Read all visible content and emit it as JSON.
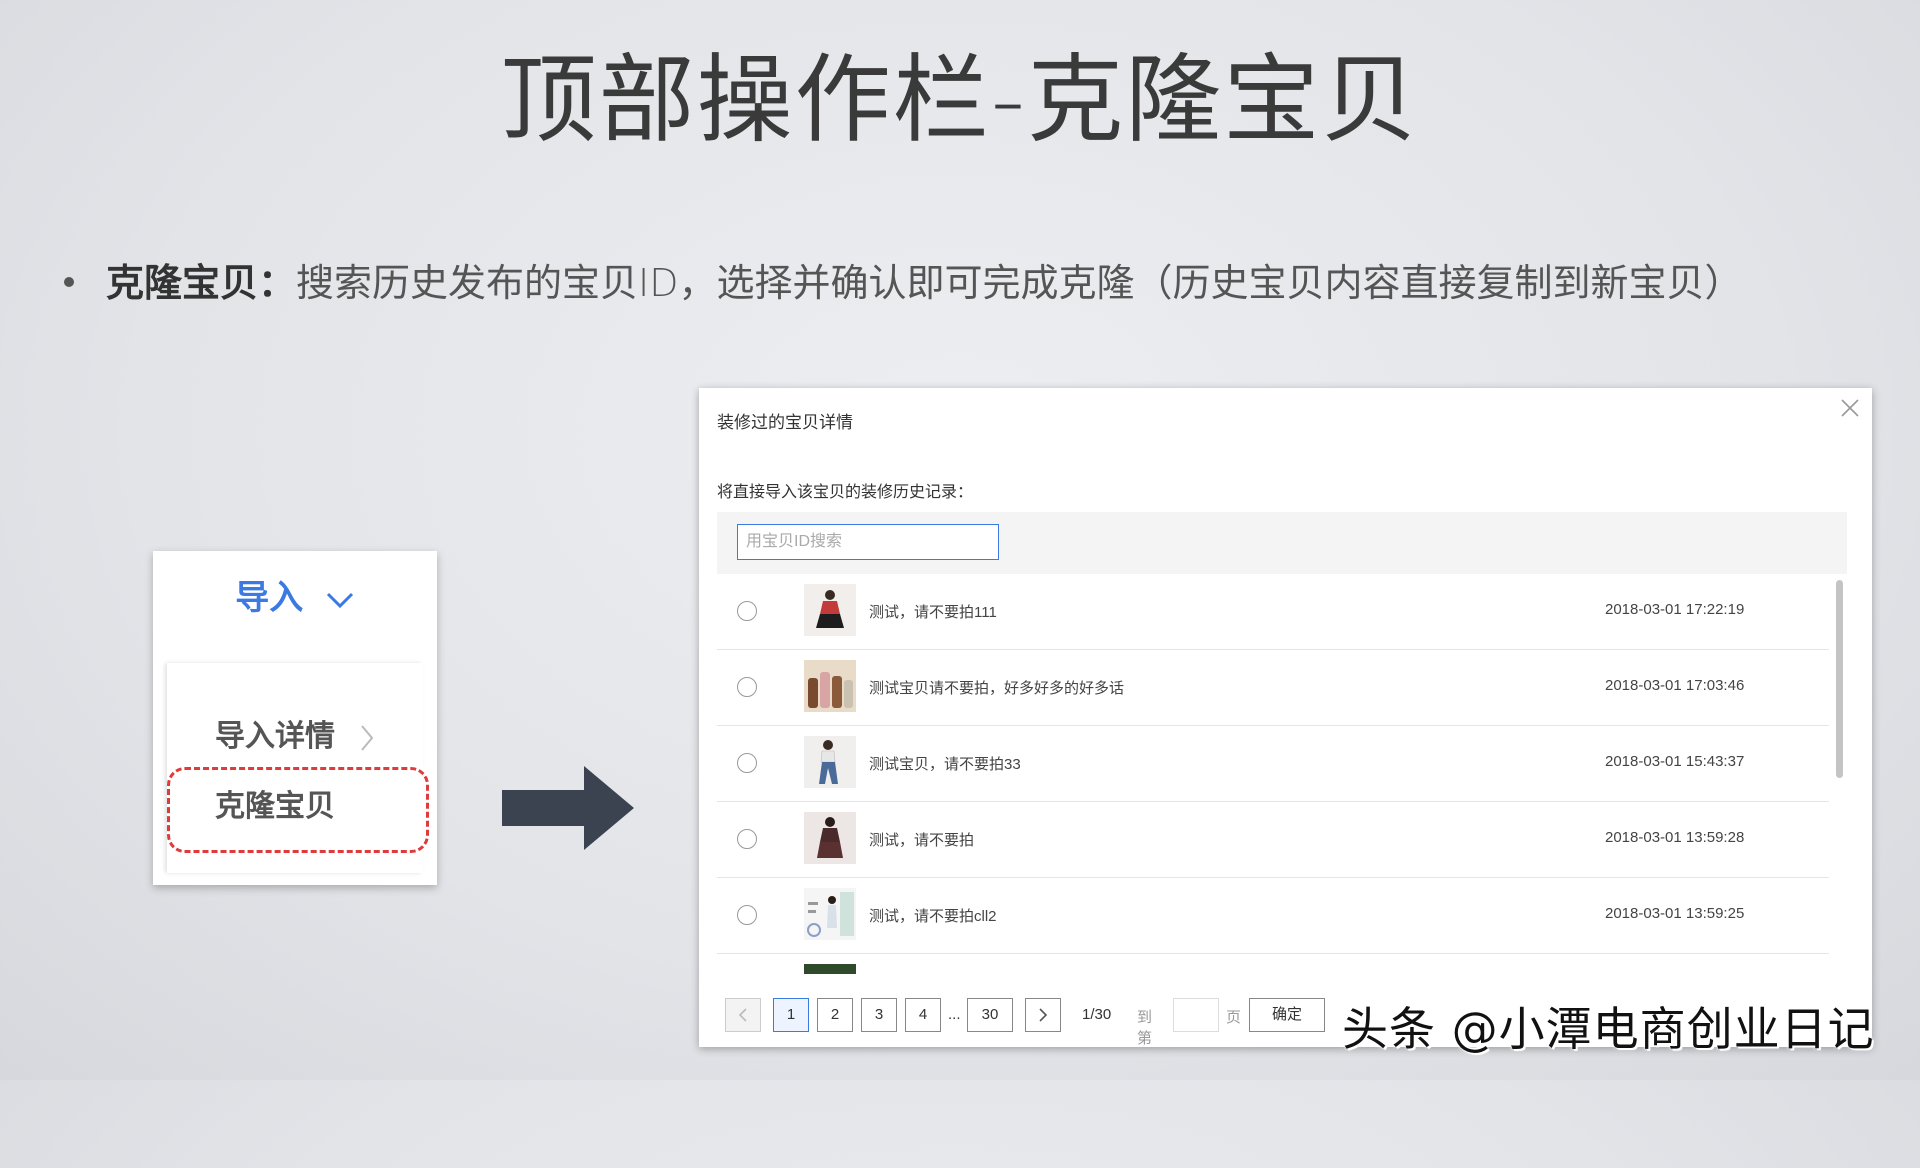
{
  "slide": {
    "title": "顶部操作栏-克隆宝贝",
    "bullet_term": "克隆宝贝：",
    "bullet_desc": "搜索历史发布的宝贝ID，选择并确认即可完成克隆（历史宝贝内容直接复制到新宝贝）"
  },
  "menu": {
    "header_label": "导入",
    "items": [
      {
        "label": "导入详情"
      },
      {
        "label": "克隆宝贝"
      }
    ],
    "highlight_color": "#e03a3a",
    "accent_color": "#3b7ae2"
  },
  "dialog": {
    "title": "装修过的宝贝详情",
    "subtitle": "将直接导入该宝贝的装修历史记录：",
    "search": {
      "placeholder": "用宝贝ID搜索",
      "value": ""
    },
    "rows": [
      {
        "name": "测试，请不要拍111",
        "time": "2018-03-01 17:22:19",
        "thumb": "thumb-dress-red"
      },
      {
        "name": "测试宝贝请不要拍，好多好多的好多话",
        "time": "2018-03-01 17:03:46",
        "thumb": "thumb-fan-bottles"
      },
      {
        "name": "测试宝贝，请不要拍33",
        "time": "2018-03-01 15:43:37",
        "thumb": "thumb-jeans"
      },
      {
        "name": "测试，请不要拍",
        "time": "2018-03-01 13:59:28",
        "thumb": "thumb-lace-dress"
      },
      {
        "name": "测试，请不要拍cll2",
        "time": "2018-03-01 13:59:25",
        "thumb": "thumb-girl-detail"
      }
    ],
    "pager": {
      "pages": [
        "1",
        "2",
        "3",
        "4"
      ],
      "ellipsis": "...",
      "last": "30",
      "status": "1/30",
      "goto_label": "到第",
      "page_unit": "页",
      "confirm_label": "确定",
      "current": "1"
    }
  },
  "watermark": "头条 @小潭电商创业日记"
}
